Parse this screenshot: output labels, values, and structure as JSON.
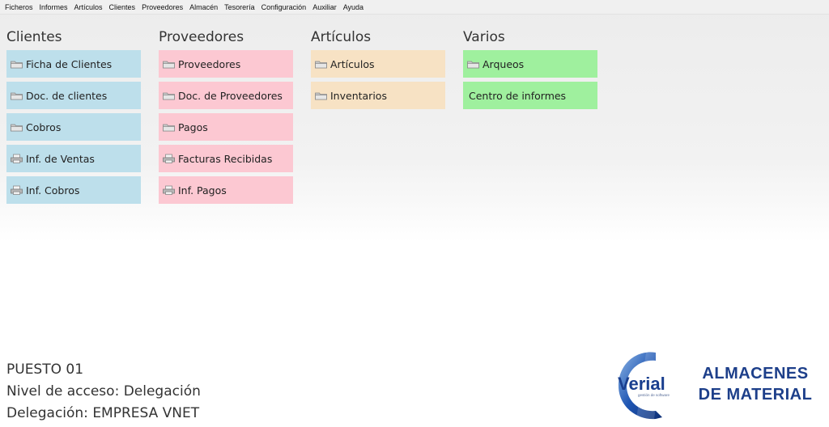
{
  "menu": {
    "items": [
      "Ficheros",
      "Informes",
      "Artículos",
      "Clientes",
      "Proveedores",
      "Almacén",
      "Tesorería",
      "Configuración",
      "Auxiliar",
      "Ayuda"
    ]
  },
  "groups": {
    "clientes": {
      "title": "Clientes",
      "color": "#bddfeb",
      "items": [
        "Ficha de Clientes",
        "Doc. de clientes",
        "Cobros",
        "Inf. de Ventas",
        "Inf. Cobros"
      ]
    },
    "proveedores": {
      "title": "Proveedores",
      "color": "#fcc8d2",
      "items": [
        "Proveedores",
        "Doc. de Proveedores",
        "Pagos",
        "Facturas Recibidas",
        "Inf. Pagos"
      ]
    },
    "articulos": {
      "title": "Artículos",
      "color": "#f7e2c4",
      "items": [
        "Artículos",
        "Inventarios"
      ]
    },
    "varios": {
      "title": "Varios",
      "color": "#9ff09e",
      "items": [
        "Arqueos",
        "Centro de informes"
      ]
    }
  },
  "status": {
    "puesto": "PUESTO 01",
    "nivel": "Nivel de acceso: Delegación",
    "delegacion": "Delegación: EMPRESA VNET"
  },
  "logo": {
    "name": "Verial",
    "sub": "gestión de software"
  },
  "brand": {
    "line1": "ALMACENES",
    "line2": "DE MATERIAL"
  },
  "icons": {
    "tile": "folder-icon",
    "report": "printer-icon"
  }
}
